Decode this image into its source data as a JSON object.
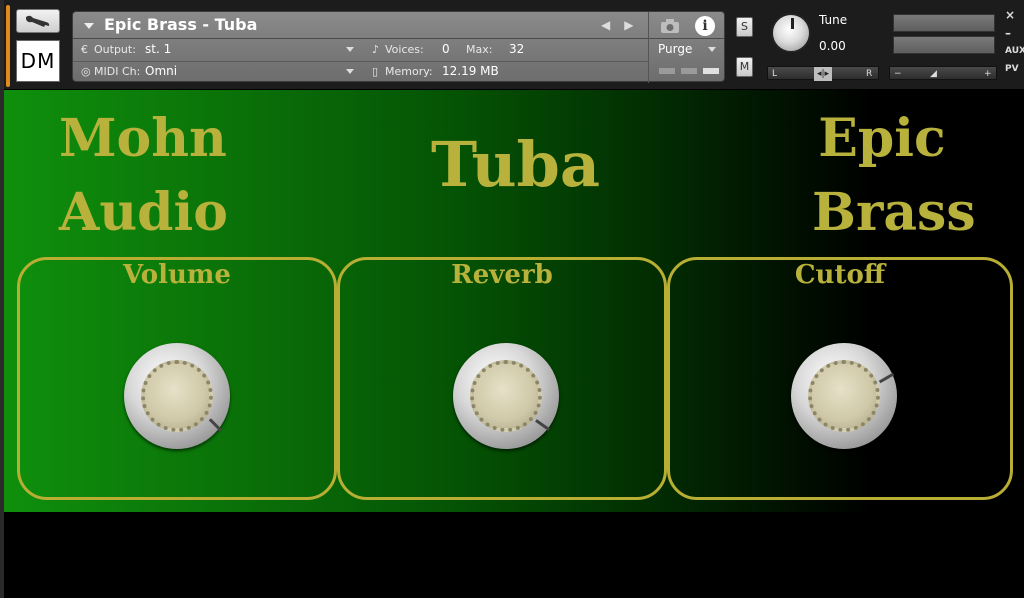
{
  "header": {
    "instrument_title": "Epic Brass - Tuba",
    "output_label": "Output:",
    "output_value": "st. 1",
    "voices_label": "Voices:",
    "voices_value": "0",
    "max_label": "Max:",
    "max_value": "32",
    "midi_label": "MIDI Ch:",
    "midi_value": "Omni",
    "memory_label": "Memory:",
    "memory_value": "12.19 MB",
    "purge_label": "Purge",
    "logo_text": "DM",
    "solo_label": "S",
    "mute_label": "M",
    "tune_label": "Tune",
    "tune_value": "0.00",
    "pan_left": "L",
    "pan_right": "R",
    "vol_minus": "−",
    "vol_plus": "+",
    "close_label": "×",
    "minimize_label": "–",
    "aux_label": "AUX",
    "pv_label": "PV"
  },
  "instrument": {
    "brand_line1": "Mohn",
    "brand_line2": "Audio",
    "title": "Tuba",
    "series_line1": "Epic",
    "series_line2": "Brass",
    "controls": [
      {
        "label": "Volume"
      },
      {
        "label": "Reverb"
      },
      {
        "label": "Cutoff"
      }
    ]
  }
}
